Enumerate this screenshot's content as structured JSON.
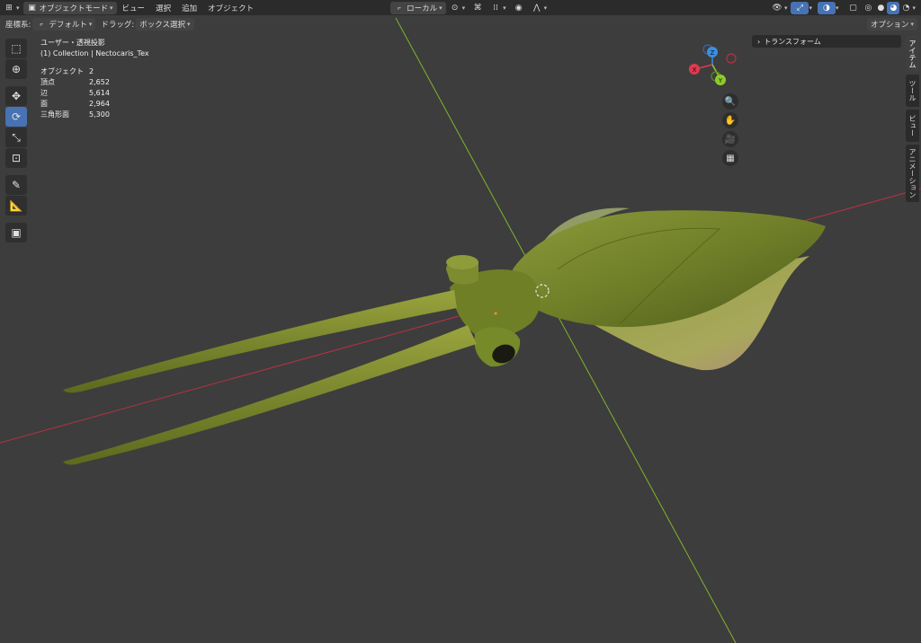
{
  "header": {
    "mode_label": "オブジェクトモード",
    "menus": [
      "ビュー",
      "選択",
      "追加",
      "オブジェクト"
    ],
    "transform_orientation": "ローカル",
    "icons": [
      "editor-type-icon",
      "object-mode-icon",
      "pivot-icon",
      "snap-icon",
      "proportional-icon",
      "visibility-icon",
      "gizmo-icon",
      "overlay-icon",
      "xray-icon",
      "shading-wireframe-icon",
      "shading-solid-icon",
      "shading-material-icon",
      "shading-rendered-icon"
    ]
  },
  "subheader": {
    "coord_label": "座標系:",
    "coord_value": "デフォルト",
    "drag_label": "ドラッグ:",
    "drag_value": "ボックス選択",
    "options_label": "オプション"
  },
  "viewport": {
    "view_name": "ユーザー・透視投影",
    "collection": "(1) Collection | Nectocaris_Tex",
    "stats": [
      {
        "label": "オブジェクト",
        "value": "2"
      },
      {
        "label": "頂点",
        "value": "2,652"
      },
      {
        "label": "辺",
        "value": "5,614"
      },
      {
        "label": "面",
        "value": "2,964"
      },
      {
        "label": "三角形面",
        "value": "5,300"
      }
    ],
    "gizmo": {
      "x": "X",
      "y": "Y",
      "z": "Z"
    }
  },
  "npanel": {
    "transform_label": "トランスフォーム",
    "tabs": [
      "アイテム",
      "ツール",
      "ビュー",
      "アニメーション"
    ]
  },
  "colors": {
    "accent": "#4772b3",
    "axis_x": "#e0394f",
    "axis_y": "#8ccc2a",
    "axis_z": "#3a8fe0",
    "model_green": "#7d8f2e"
  }
}
